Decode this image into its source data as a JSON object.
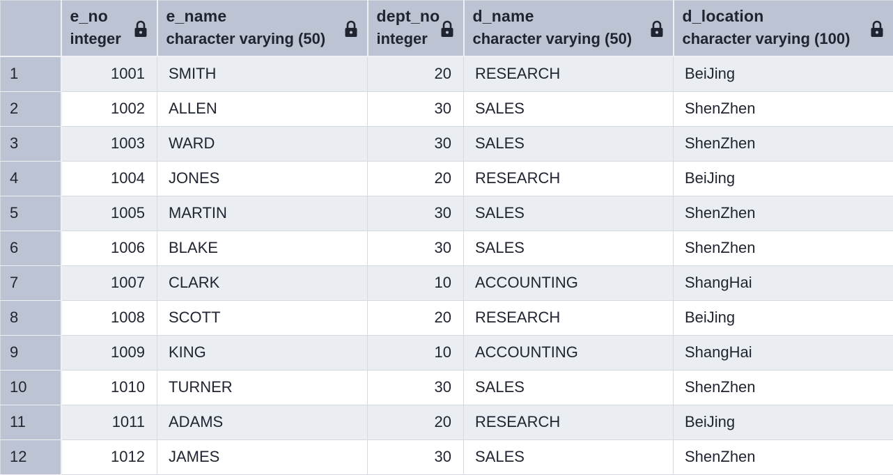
{
  "columns": [
    {
      "name": "e_no",
      "type": "integer"
    },
    {
      "name": "e_name",
      "type": "character varying (50)"
    },
    {
      "name": "dept_no",
      "type": "integer"
    },
    {
      "name": "d_name",
      "type": "character varying (50)"
    },
    {
      "name": "d_location",
      "type": "character varying (100)"
    }
  ],
  "rows": [
    {
      "row": "1",
      "e_no": "1001",
      "e_name": "SMITH",
      "dept_no": "20",
      "d_name": "RESEARCH",
      "d_location": "BeiJing"
    },
    {
      "row": "2",
      "e_no": "1002",
      "e_name": "ALLEN",
      "dept_no": "30",
      "d_name": "SALES",
      "d_location": "ShenZhen"
    },
    {
      "row": "3",
      "e_no": "1003",
      "e_name": "WARD",
      "dept_no": "30",
      "d_name": "SALES",
      "d_location": "ShenZhen"
    },
    {
      "row": "4",
      "e_no": "1004",
      "e_name": "JONES",
      "dept_no": "20",
      "d_name": "RESEARCH",
      "d_location": "BeiJing"
    },
    {
      "row": "5",
      "e_no": "1005",
      "e_name": "MARTIN",
      "dept_no": "30",
      "d_name": "SALES",
      "d_location": "ShenZhen"
    },
    {
      "row": "6",
      "e_no": "1006",
      "e_name": "BLAKE",
      "dept_no": "30",
      "d_name": "SALES",
      "d_location": "ShenZhen"
    },
    {
      "row": "7",
      "e_no": "1007",
      "e_name": "CLARK",
      "dept_no": "10",
      "d_name": "ACCOUNTING",
      "d_location": "ShangHai"
    },
    {
      "row": "8",
      "e_no": "1008",
      "e_name": "SCOTT",
      "dept_no": "20",
      "d_name": "RESEARCH",
      "d_location": "BeiJing"
    },
    {
      "row": "9",
      "e_no": "1009",
      "e_name": "KING",
      "dept_no": "10",
      "d_name": "ACCOUNTING",
      "d_location": "ShangHai"
    },
    {
      "row": "10",
      "e_no": "1010",
      "e_name": "TURNER",
      "dept_no": "30",
      "d_name": "SALES",
      "d_location": "ShenZhen"
    },
    {
      "row": "11",
      "e_no": "1011",
      "e_name": "ADAMS",
      "dept_no": "20",
      "d_name": "RESEARCH",
      "d_location": "BeiJing"
    },
    {
      "row": "12",
      "e_no": "1012",
      "e_name": "JAMES",
      "dept_no": "30",
      "d_name": "SALES",
      "d_location": "ShenZhen"
    }
  ],
  "icons": {
    "column_lock": "lock-icon"
  },
  "colors": {
    "header_bg": "#bcc3d2",
    "row_odd_bg": "#eaedf2",
    "row_even_bg": "#ffffff",
    "text": "#1f2430"
  }
}
